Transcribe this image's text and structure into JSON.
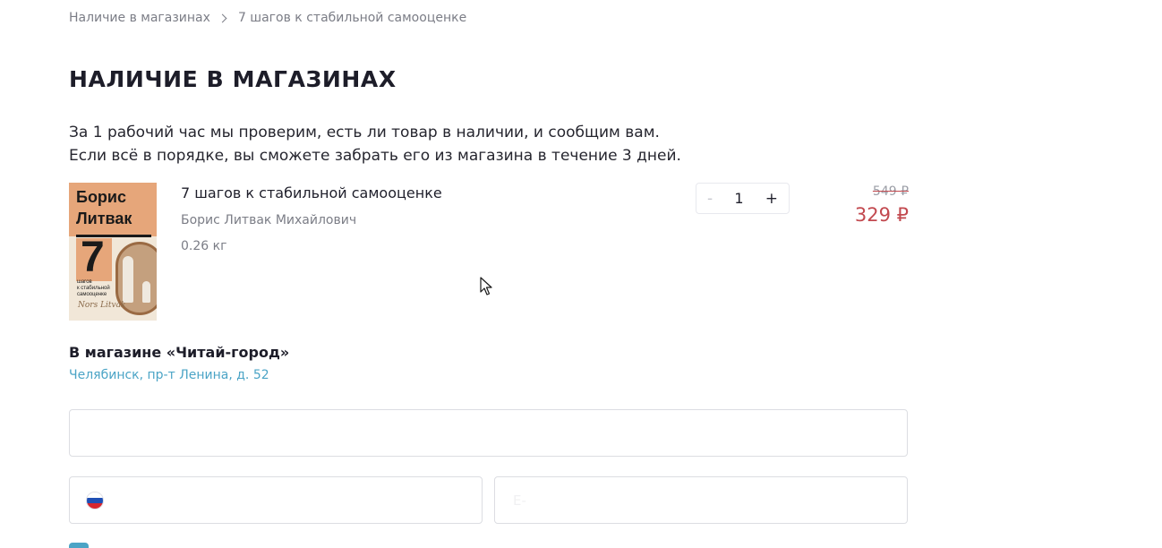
{
  "breadcrumb": {
    "items": [
      "Наличие в магазинах",
      "7 шагов к стабильной самооценке"
    ]
  },
  "page_title": "НАЛИЧИЕ В МАГАЗИНАХ",
  "description": {
    "line1": "За 1 рабочий час мы проверим, есть ли товар в наличии, и сообщим вам.",
    "line2": "Если всё в порядке, вы сможете забрать его из магазина в течение 3 дней."
  },
  "product": {
    "title": "7 шагов к стабильной самооценке",
    "author": "Борис Литвак Михайлович",
    "weight": "0.26 кг",
    "old_price": "549 ₽",
    "price": "329 ₽",
    "quantity": "1",
    "cover": {
      "author_line1": "Борис",
      "author_line2": "Литвак",
      "number": "7",
      "subtitle_line1": "шагов",
      "subtitle_line2": "к стабильной",
      "subtitle_line3": "самооценке",
      "signature": "Nors Litvak"
    }
  },
  "stepper": {
    "minus_label": "-",
    "plus_label": "+"
  },
  "store": {
    "title": "В магазине «Читай-город»",
    "address": "Челябинск, пр-т Ленина, д. 52"
  },
  "form": {
    "name_placeholder": "",
    "phone_placeholder": "",
    "email_placeholder": "E-"
  },
  "icons": {
    "breadcrumb_separator": "chevron-right-icon",
    "phone_flag": "russia-flag-icon",
    "cursor": "mouse-pointer-icon"
  },
  "colors": {
    "price": "#c2494f",
    "link": "#4ba4c6",
    "muted": "#7b7d86"
  }
}
